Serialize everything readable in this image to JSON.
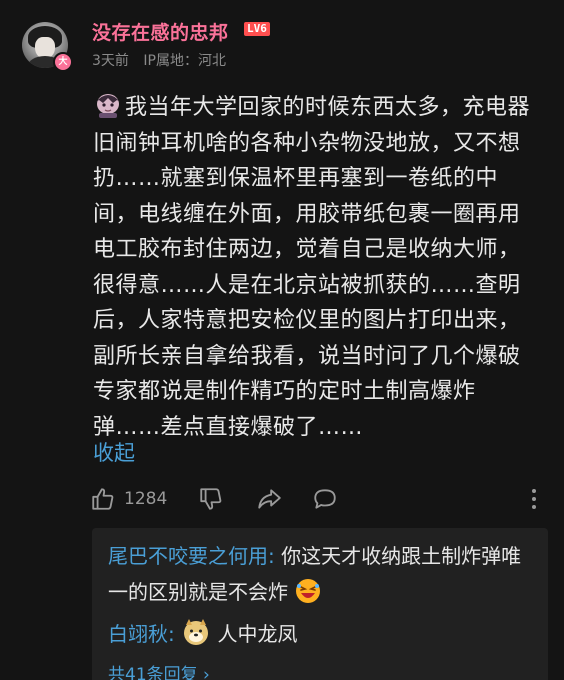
{
  "user": {
    "name": "没存在感的忠邦",
    "level": "LV6",
    "time": "3天前",
    "ip_location": "IP属地：河北"
  },
  "comment": {
    "text": "我当年大学回家的时候东西太多，充电器旧闹钟耳机啥的各种小杂物没地放，又不想扔……就塞到保温杯里再塞到一卷纸的中间，电线缠在外面，用胶带纸包裹一圈再用电工胶布封住两边，觉着自己是收纳大师，很得意……人是在北京站被抓获的……查明后，人家特意把安检仪里的图片打印出来，副所长亲自拿给我看，说当时问了几个爆破专家都说是制作精巧的定时土制高爆炸弹……差点直接爆破了……",
    "collapse_label": "收起"
  },
  "actions": {
    "like_count": "1284",
    "icons": [
      "thumb-up-icon",
      "thumb-down-icon",
      "share-icon",
      "reply-icon",
      "more-icon"
    ]
  },
  "replies": [
    {
      "author": "尾巴不咬要之何用:",
      "text": "你这天才收纳跟土制炸弹唯一的区别就是不会炸",
      "emoji": "laughing-emoji"
    },
    {
      "author": "白翊秋:",
      "emoji": "doge-emoji",
      "text": "人中龙凤"
    }
  ],
  "more_replies_label": "共41条回复 ›",
  "colors": {
    "background": "#141414",
    "username": "#fb7299",
    "link": "#4a9fd6",
    "level_badge": "#ff4f4f",
    "reply_box": "#212121"
  }
}
